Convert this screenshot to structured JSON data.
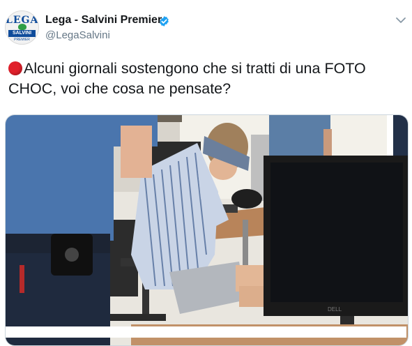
{
  "tweet": {
    "display_name": "Lega - Salvini Premier",
    "handle": "@LegaSalvini",
    "verified_icon": "verified-badge-icon",
    "menu_icon": "chevron-down-icon",
    "text": "Alcuni giornali sostengono che si tratti di una FOTO CHOC, voi che cosa ne pensate?",
    "emoji": "red-circle-icon",
    "avatar": {
      "logo_text": "LEGA",
      "band_text": "SALVINI",
      "sub_text": "PREMIER"
    }
  },
  "media": {
    "type": "photo",
    "monitor_brand": "DELL"
  },
  "colors": {
    "text": "#14171a",
    "handle": "#657786",
    "verified": "#1da1f2",
    "emoji_red": "#e0202b",
    "border": "#ccd6dd"
  }
}
